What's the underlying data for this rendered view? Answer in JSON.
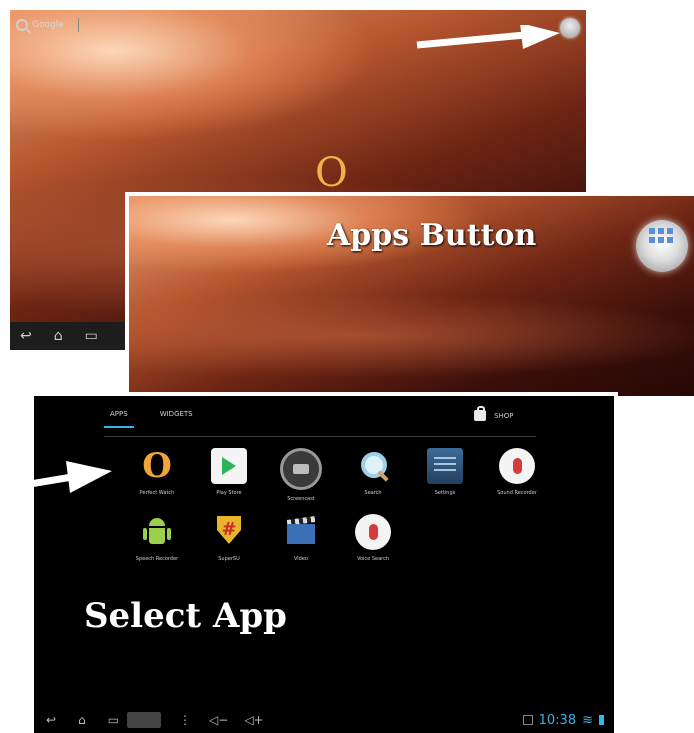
{
  "panel_home": {
    "search_label": "Google",
    "wallpaper_logo": "O",
    "nav_icons": [
      "back-icon",
      "home-icon",
      "recent-apps-icon"
    ]
  },
  "panel_zoom": {
    "caption": "Apps Button"
  },
  "drawer": {
    "tabs": [
      {
        "label": "APPS",
        "active": true
      },
      {
        "label": "WIDGETS",
        "active": false
      }
    ],
    "shop_label": "SHOP",
    "apps": [
      {
        "label": "Perfect Watch",
        "icon": "o-logo-icon"
      },
      {
        "label": "Play Store",
        "icon": "play-store-icon"
      },
      {
        "label": "Screencast",
        "icon": "camera-icon"
      },
      {
        "label": "Search",
        "icon": "search-icon"
      },
      {
        "label": "Settings",
        "icon": "settings-icon"
      },
      {
        "label": "Sound Recorder",
        "icon": "microphone-icon"
      },
      {
        "label": "Speech Recorder",
        "icon": "android-icon"
      },
      {
        "label": "SuperSU",
        "icon": "supersu-icon"
      },
      {
        "label": "Video",
        "icon": "clapperboard-icon"
      },
      {
        "label": "Voice Search",
        "icon": "microphone-icon"
      }
    ],
    "caption": "Select App",
    "status_time": "10:38"
  },
  "colors": {
    "accent": "#33b5e5",
    "caption": "#ffffff",
    "drawer_bg": "#000000"
  }
}
